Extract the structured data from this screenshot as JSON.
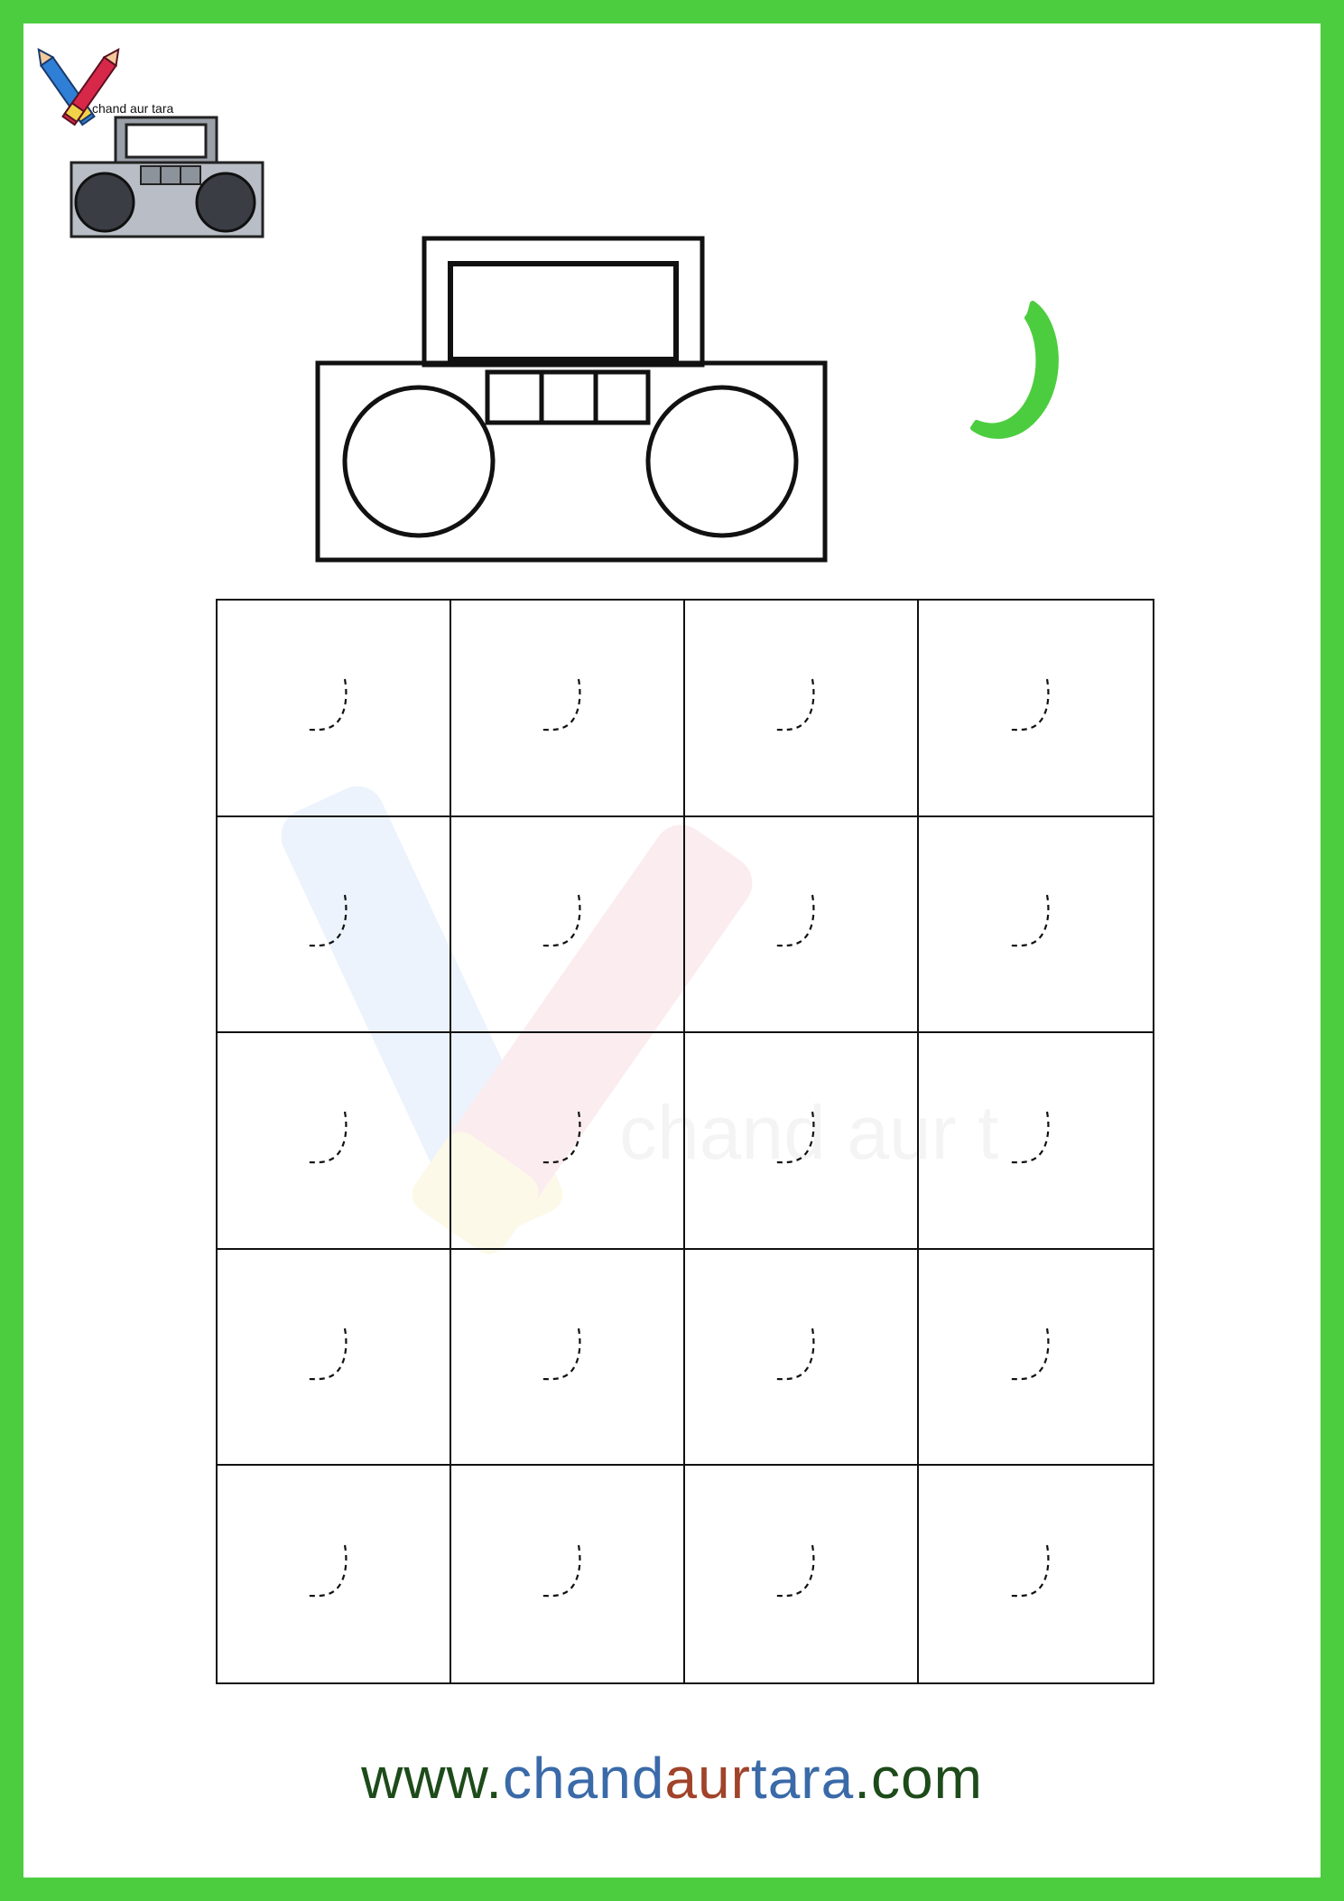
{
  "brand": {
    "logo_text": "chand aur tara"
  },
  "letter": {
    "glyph": "ر",
    "color": "#4ccd3f"
  },
  "worksheet": {
    "rows": 5,
    "columns": 4,
    "trace_glyph": "ر"
  },
  "footer": {
    "www": "www.",
    "chand": "chand",
    "aur": "aur",
    "tara": "tara",
    "com": ".com"
  },
  "watermark": {
    "text": "chand aur t"
  },
  "colors": {
    "border": "#4ccd3f",
    "footer_dark": "#1d4b1a",
    "footer_blue": "#3a6aa8",
    "footer_brown": "#a0432a"
  }
}
